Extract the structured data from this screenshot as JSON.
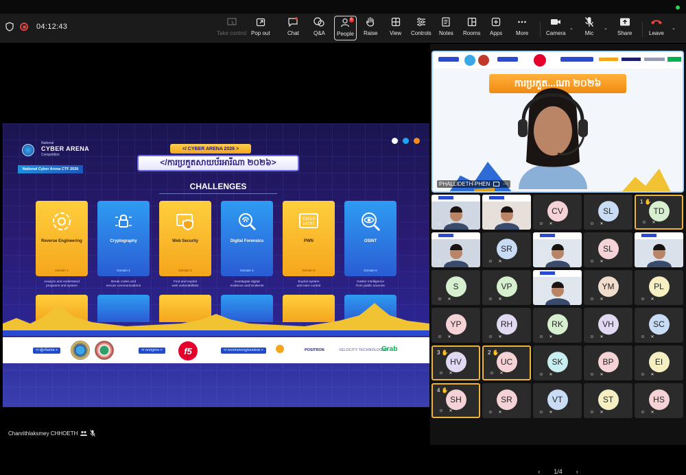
{
  "meeting": {
    "timer": "04:12:43",
    "presenter_name": "Chanrithlaksmey CHHOETH",
    "active_speaker": "PHALLIDETH-PHEN",
    "page_indicator": "1/4",
    "page_prev": "‹",
    "page_next": "›"
  },
  "toolbar": {
    "take_control": "Take control",
    "pop_out": "Pop out",
    "chat": "Chat",
    "qa": "Q&A",
    "people": "People",
    "people_badge": "6",
    "raise": "Raise",
    "view": "View",
    "controls": "Controls",
    "notes": "Notes",
    "rooms": "Rooms",
    "apps": "Apps",
    "more": "More",
    "camera": "Camera",
    "mic": "Mic",
    "share": "Share",
    "leave": "Leave"
  },
  "slide": {
    "logo_line1": "National",
    "logo_line2": "CYBER ARENA",
    "logo_line3": "Competition",
    "logo_ribbon": "National Cyber Arena CTF 2026",
    "top_pill": "</ CYBER ARENA 2026 >",
    "main_title": "</ការប្រកួតសាយប័រអារីណា ២០២៦>",
    "challenges_label": "CHALLENGES",
    "cards": [
      {
        "name": "Reverse Engineering",
        "domain": "Domain 1",
        "desc1": "Analyze and understand",
        "desc2": "programs and system",
        "style": "gold"
      },
      {
        "name": "Cryptography",
        "domain": "Domain 2",
        "desc1": "Break codes and",
        "desc2": "secure communications",
        "style": "blue"
      },
      {
        "name": "Web Security",
        "domain": "Domain 3",
        "desc1": "Find and exploit",
        "desc2": "web vulnerabilities",
        "style": "gold"
      },
      {
        "name": "Digital Forensics",
        "domain": "Domain 4",
        "desc1": "Investigate digital",
        "desc2": "evidence and incidents",
        "style": "blue"
      },
      {
        "name": "PWN",
        "domain": "Domain 5",
        "desc1": "Exploit system",
        "desc2": "and earn control",
        "style": "gold"
      },
      {
        "name": "OSINT",
        "domain": "Domain 6",
        "desc1": "Gather intelligence",
        "desc2": "from public sources",
        "style": "blue"
      }
    ],
    "pwn_glyph_1": "01010",
    "pwn_glyph_2": "10101",
    "footer_tag1": "</ រៀបចំដោយ >",
    "footer_tag2": "</ សហគ្រាស >",
    "footer_tag3": "</ សហការសហគ្រាសដោយ >",
    "f5_logo": "f5",
    "sponsor_positron": "POSITRON",
    "sponsor_velocity": "VELOCITY TECHNOLOGIES",
    "sponsor_grab": "Grab",
    "active_title": "ការប្រកួត...ណា ២០២៦"
  },
  "participants": [
    {
      "initials": "",
      "video": true,
      "hand": "",
      "color": ""
    },
    {
      "initials": "",
      "video": true,
      "hand": "",
      "color": ""
    },
    {
      "initials": "CV",
      "video": false,
      "hand": "",
      "color": "#f5d2d6"
    },
    {
      "initials": "SL",
      "video": false,
      "hand": "",
      "color": "#c9dcf5"
    },
    {
      "initials": "TD",
      "video": false,
      "hand": "1",
      "color": "#d6efcf"
    },
    {
      "initials": "",
      "video": true,
      "hand": "",
      "color": ""
    },
    {
      "initials": "SR",
      "video": false,
      "hand": "",
      "color": "#c9dcf5"
    },
    {
      "initials": "",
      "video": true,
      "hand": "",
      "color": ""
    },
    {
      "initials": "SL",
      "video": false,
      "hand": "",
      "color": "#f5d2d6"
    },
    {
      "initials": "",
      "video": true,
      "hand": "",
      "color": ""
    },
    {
      "initials": "S",
      "video": false,
      "hand": "",
      "color": "#d6efcf"
    },
    {
      "initials": "VP",
      "video": false,
      "hand": "",
      "color": "#d6efcf"
    },
    {
      "initials": "",
      "video": true,
      "hand": "",
      "color": ""
    },
    {
      "initials": "YM",
      "video": false,
      "hand": "",
      "color": "#f0dccc"
    },
    {
      "initials": "PL",
      "video": false,
      "hand": "",
      "color": "#f5efc2"
    },
    {
      "initials": "YP",
      "video": false,
      "hand": "",
      "color": "#f5d2d6"
    },
    {
      "initials": "RH",
      "video": false,
      "hand": "",
      "color": "#e1d9f2"
    },
    {
      "initials": "RK",
      "video": false,
      "hand": "",
      "color": "#d6efcf"
    },
    {
      "initials": "VH",
      "video": false,
      "hand": "",
      "color": "#e1d9f2"
    },
    {
      "initials": "SC",
      "video": false,
      "hand": "",
      "color": "#c9dcf5"
    },
    {
      "initials": "HV",
      "video": false,
      "hand": "3",
      "color": "#e1d9f2"
    },
    {
      "initials": "UC",
      "video": false,
      "hand": "2",
      "color": "#f5d2d6"
    },
    {
      "initials": "SK",
      "video": false,
      "hand": "",
      "color": "#c9eef0"
    },
    {
      "initials": "BP",
      "video": false,
      "hand": "",
      "color": "#f5d2d6"
    },
    {
      "initials": "EI",
      "video": false,
      "hand": "",
      "color": "#f5efc2"
    },
    {
      "initials": "SH",
      "video": false,
      "hand": "4",
      "color": "#f5d2d6"
    },
    {
      "initials": "SR",
      "video": false,
      "hand": "",
      "color": "#f5d2d6"
    },
    {
      "initials": "VT",
      "video": false,
      "hand": "",
      "color": "#c9dcf5"
    },
    {
      "initials": "ST",
      "video": false,
      "hand": "",
      "color": "#f5efc2"
    },
    {
      "initials": "HS",
      "video": false,
      "hand": "",
      "color": "#f5d2d6"
    }
  ]
}
